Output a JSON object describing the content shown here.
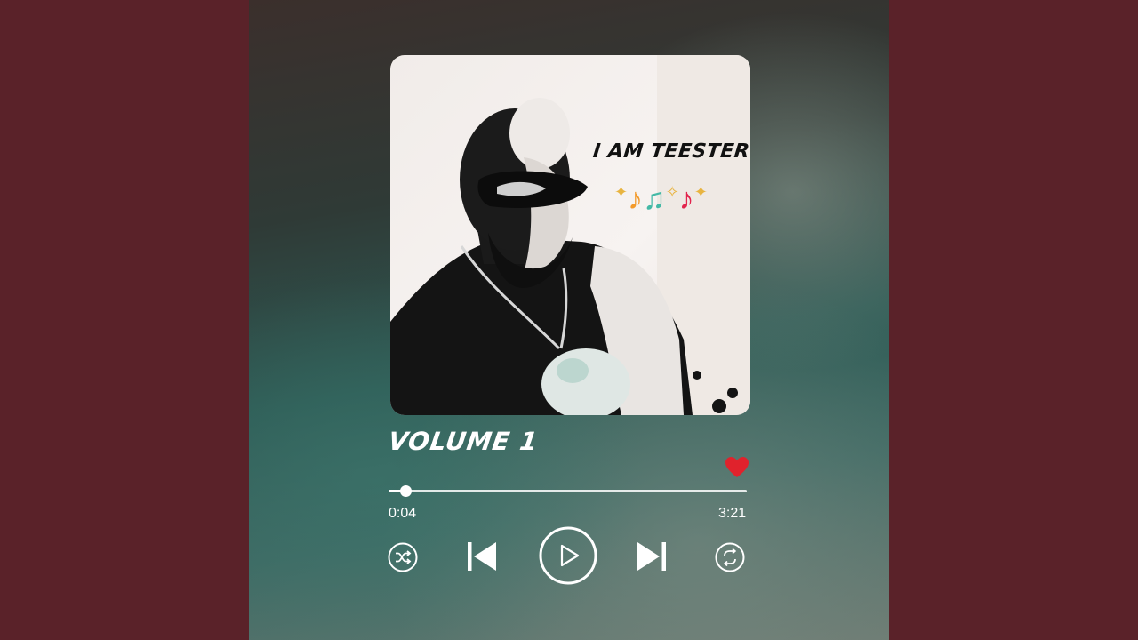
{
  "cover": {
    "artist_text": "I AM TEESTER",
    "notes_icon": "music-notes-icon"
  },
  "track": {
    "title": "VOLUME 1",
    "liked": true,
    "heart_color": "#e0222c",
    "progress_fraction": 0.046
  },
  "time": {
    "elapsed": "0:04",
    "total": "3:21"
  },
  "controls": {
    "shuffle_icon": "shuffle-icon",
    "prev_icon": "skip-previous-icon",
    "play_icon": "play-icon",
    "next_icon": "skip-next-icon",
    "repeat_icon": "repeat-icon"
  },
  "colors": {
    "side_panels": "#5a2229",
    "foreground": "#ffffff"
  }
}
